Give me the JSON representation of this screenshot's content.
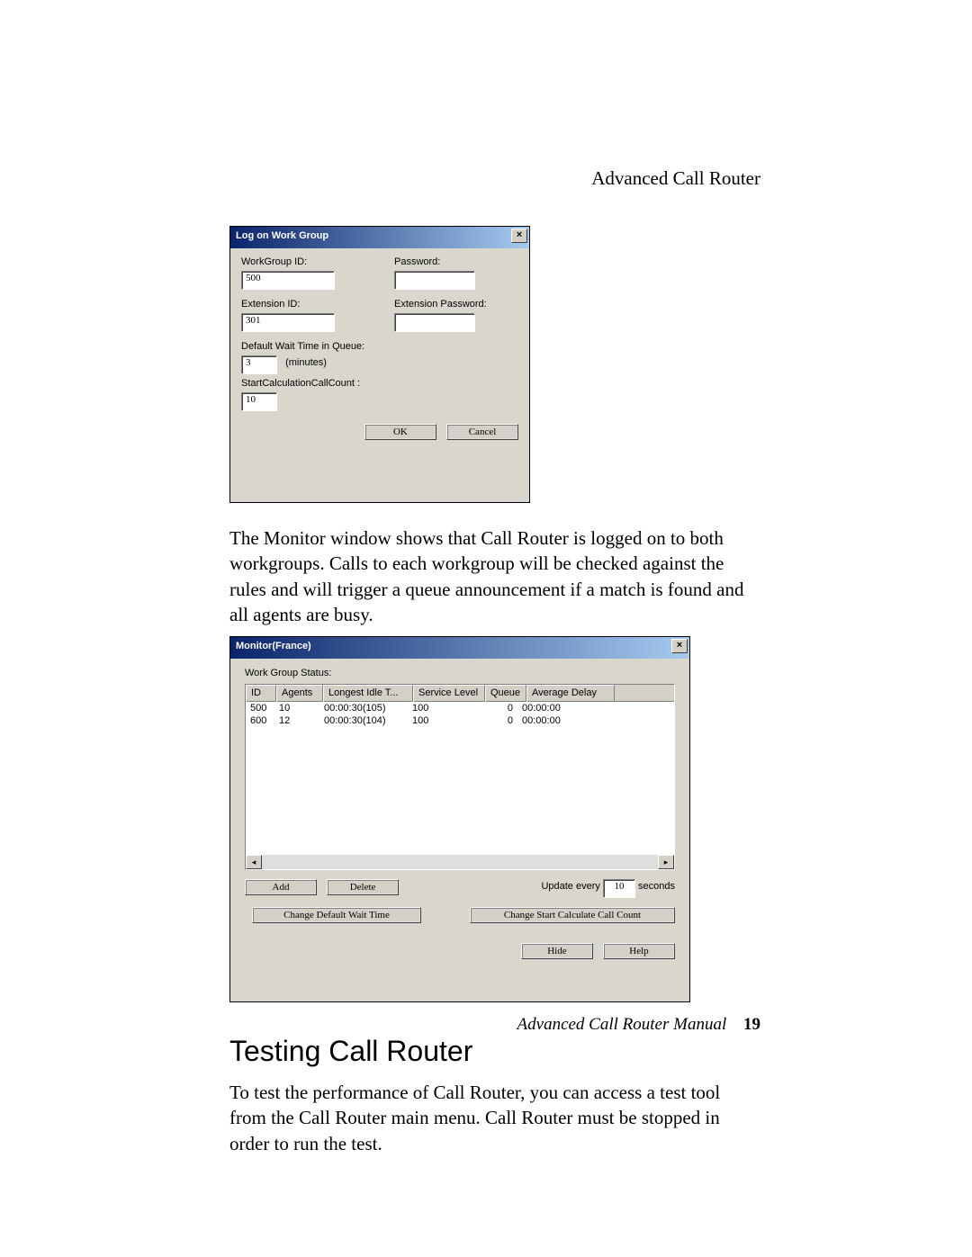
{
  "header": {
    "title": "Advanced Call Router"
  },
  "dialog1": {
    "title": "Log on Work Group",
    "workgroup_id_label": "WorkGroup ID:",
    "workgroup_id_value": "500",
    "password_label": "Password:",
    "password_value": "",
    "extension_id_label": "Extension ID:",
    "extension_id_value": "301",
    "ext_password_label": "Extension Password:",
    "ext_password_value": "",
    "wait_time_label": "Default Wait Time in Queue:",
    "wait_time_value": "3",
    "minutes_label": "(minutes)",
    "start_calc_label": "StartCalculationCallCount :",
    "start_calc_value": "10",
    "ok_label": "OK",
    "cancel_label": "Cancel"
  },
  "para1": "The Monitor window shows that Call Router is logged on to both workgroups. Calls to each workgroup will be checked against the rules and will trigger a queue announcement if a match is found and all agents are busy.",
  "dialog2": {
    "title": "Monitor(France)",
    "status_label": "Work Group Status:",
    "columns": [
      "ID",
      "Agents",
      "Longest Idle T...",
      "Service Level",
      "Queue",
      "Average Delay"
    ],
    "rows": [
      {
        "id": "500",
        "agents": "10",
        "idle": "00:00:30(105)",
        "sl": "100",
        "queue": "0",
        "delay": "00:00:00"
      },
      {
        "id": "600",
        "agents": "12",
        "idle": "00:00:30(104)",
        "sl": "100",
        "queue": "0",
        "delay": "00:00:00"
      }
    ],
    "add_label": "Add",
    "delete_label": "Delete",
    "update_pre": "Update every",
    "update_value": "10",
    "update_post": "seconds",
    "change_wait_label": "Change Default Wait Time",
    "change_start_label": "Change Start Calculate Call Count",
    "hide_label": "Hide",
    "help_label": "Help"
  },
  "section_heading": "Testing Call Router",
  "para2": "To test the performance of Call Router, you can access a test tool from the Call Router main menu. Call Router must be stopped in order to run the test.",
  "footer": {
    "text": "Advanced Call Router Manual",
    "page": "19"
  }
}
